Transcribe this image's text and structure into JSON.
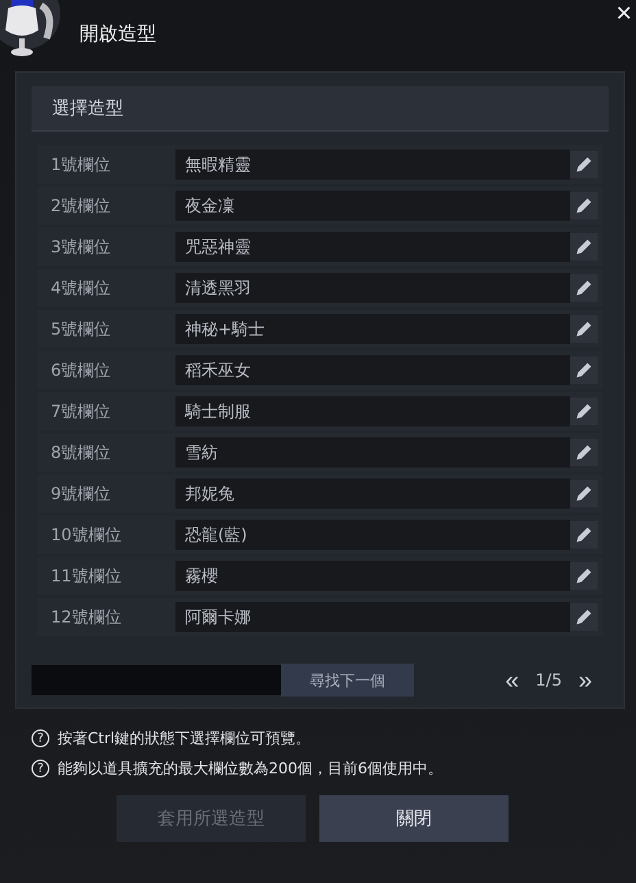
{
  "window": {
    "title": "開啟造型",
    "close": "×"
  },
  "panel": {
    "title": "選擇造型"
  },
  "slots": [
    {
      "label": "1號欄位",
      "value": "無暇精靈"
    },
    {
      "label": "2號欄位",
      "value": "夜金凜"
    },
    {
      "label": "3號欄位",
      "value": "咒惡神靈"
    },
    {
      "label": "4號欄位",
      "value": "清透黑羽"
    },
    {
      "label": "5號欄位",
      "value": "神秘+騎士"
    },
    {
      "label": "6號欄位",
      "value": "稻禾巫女"
    },
    {
      "label": "7號欄位",
      "value": "騎士制服"
    },
    {
      "label": "8號欄位",
      "value": "雪紡"
    },
    {
      "label": "9號欄位",
      "value": "邦妮兔"
    },
    {
      "label": "10號欄位",
      "value": "恐龍(藍)"
    },
    {
      "label": "11號欄位",
      "value": "霧櫻"
    },
    {
      "label": "12號欄位",
      "value": "阿爾卡娜"
    }
  ],
  "search": {
    "button": "尋找下一個"
  },
  "pager": {
    "prev": "«",
    "page": "1/5",
    "next": "»"
  },
  "notes": [
    {
      "icon": "?",
      "text": "按著Ctrl鍵的狀態下選擇欄位可預覽。"
    },
    {
      "icon": "?",
      "text": "能夠以道具擴充的最大欄位數為200個，目前6個使用中。"
    }
  ],
  "buttons": [
    {
      "label": "套用所選造型",
      "disabled": true
    },
    {
      "label": "關閉",
      "disabled": false
    }
  ]
}
